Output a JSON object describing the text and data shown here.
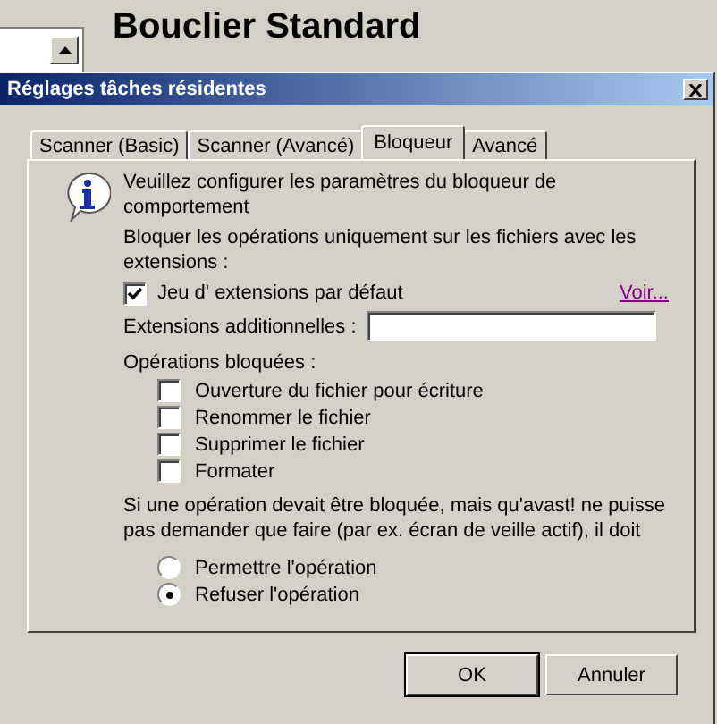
{
  "background_window": {
    "heading": "Bouclier Standard"
  },
  "dialog": {
    "title": "Réglages tâches résidentes",
    "tabs": [
      {
        "label": "Scanner (Basic)",
        "selected": false
      },
      {
        "label": "Scanner (Avancé)",
        "selected": false
      },
      {
        "label": "Bloqueur",
        "selected": true
      },
      {
        "label": "Avancé",
        "selected": false
      }
    ],
    "intro": "Veuillez configurer les paramètres du bloqueur de comportement",
    "extensions_label": "Bloquer les opérations uniquement sur les fichiers avec les extensions :",
    "default_extensions": {
      "label": "Jeu d' extensions par défaut",
      "checked": true
    },
    "view_link": "Voir...",
    "additional_extensions": {
      "label": "Extensions additionnelles :"
    },
    "blocked_operations_label": "Opérations bloquées :",
    "blocked_operations": [
      {
        "label": "Ouverture du fichier pour écriture",
        "checked": false
      },
      {
        "label": "Renommer le fichier",
        "checked": false
      },
      {
        "label": "Supprimer le fichier",
        "checked": false
      },
      {
        "label": "Formater",
        "checked": false
      }
    ],
    "fallback_text": "Si une opération devait être bloquée, mais qu'avast! ne puisse pas demander que faire (par ex. écran de veille actif), il doit",
    "fallback_options": [
      {
        "label": "Permettre l'opération",
        "selected": false
      },
      {
        "label": "Refuser l'opération",
        "selected": true
      }
    ],
    "buttons": [
      "OK",
      "Annuler"
    ]
  }
}
